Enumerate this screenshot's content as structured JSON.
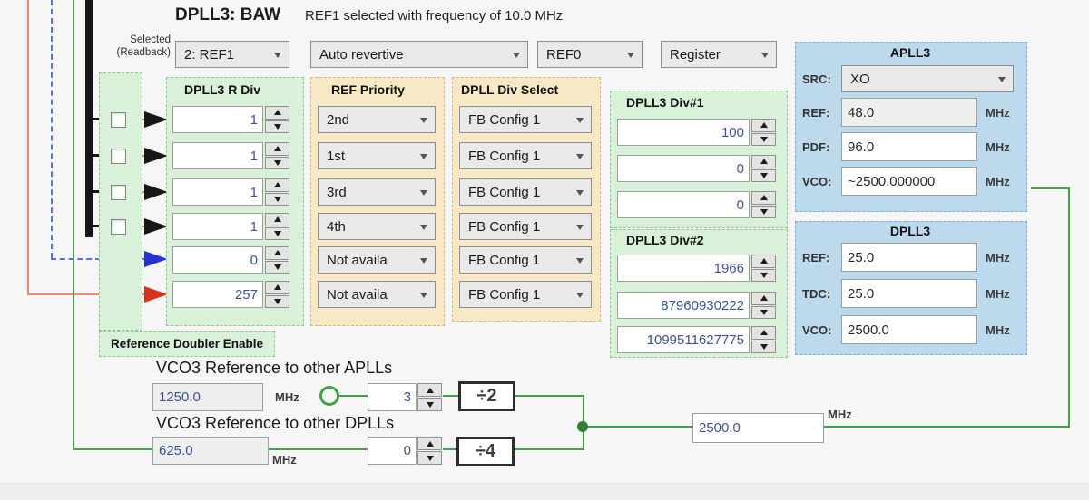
{
  "header": {
    "title": "DPLL3: BAW",
    "status_text": "REF1 selected with frequency of 10.0 MHz",
    "selected_label_line1": "Selected",
    "selected_label_line2": "(Readback)",
    "selected_ref": "2: REF1",
    "revertive_mode": "Auto revertive",
    "ref_select": "REF0",
    "control_mode": "Register"
  },
  "r_div": {
    "title": "DPLL3 R Div",
    "values": [
      "1",
      "1",
      "1",
      "1",
      "0",
      "257"
    ]
  },
  "ref_priority": {
    "title": "REF Priority",
    "values": [
      "2nd",
      "1st",
      "3rd",
      "4th",
      "Not availa",
      "Not availa"
    ]
  },
  "dpll_div_select": {
    "title": "DPLL Div Select",
    "values": [
      "FB Config 1",
      "FB Config 1",
      "FB Config 1",
      "FB Config 1",
      "FB Config 1",
      "FB Config 1"
    ]
  },
  "dpll3_div1": {
    "title": "DPLL3 Div#1",
    "values": [
      "100",
      "0",
      "0"
    ]
  },
  "dpll3_div2": {
    "title": "DPLL3 Div#2",
    "values": [
      "1966",
      "87960930222",
      "1099511627775"
    ]
  },
  "apll3": {
    "title": "APLL3",
    "src_label": "SRC:",
    "src_value": "XO",
    "rows": [
      {
        "label": "REF:",
        "value": "48.0",
        "unit": "MHz"
      },
      {
        "label": "PDF:",
        "value": "96.0",
        "unit": "MHz"
      },
      {
        "label": "VCO:",
        "value": "~2500.000000",
        "unit": "MHz"
      }
    ]
  },
  "dpll3_box": {
    "title": "DPLL3",
    "rows": [
      {
        "label": "REF:",
        "value": "25.0",
        "unit": "MHz"
      },
      {
        "label": "TDC:",
        "value": "25.0",
        "unit": "MHz"
      },
      {
        "label": "VCO:",
        "value": "2500.0",
        "unit": "MHz"
      }
    ]
  },
  "doubler": {
    "label": "Reference Doubler Enable"
  },
  "vco3_apll": {
    "title": "VCO3 Reference to other APLLs",
    "frequency": "1250.0",
    "unit": "MHz",
    "post_div": "3",
    "divider_label": "÷2"
  },
  "vco3_dpll": {
    "title": "VCO3 Reference to other DPLLs",
    "frequency": "625.0",
    "unit": "MHz",
    "post_div": "0",
    "divider_label": "÷4"
  },
  "output": {
    "frequency": "2500.0",
    "unit": "MHz"
  },
  "colors": {
    "panel_green": "#d9f0d9",
    "panel_tan": "#f8e9c6",
    "panel_blue": "#bdd9ec",
    "wire_green": "#43a047",
    "wire_red": "#d8321f",
    "wire_blue": "#2633cf",
    "value_blue": "#3d5390",
    "bus_black": "#161616"
  }
}
